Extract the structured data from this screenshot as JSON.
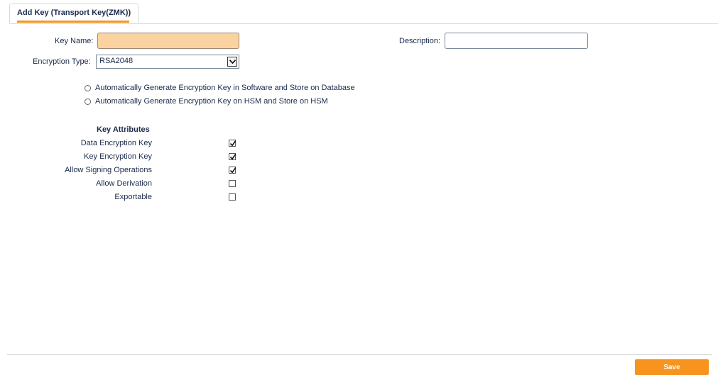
{
  "tab": {
    "label": "Add Key (Transport Key(ZMK))",
    "accent_color": "#f7941d"
  },
  "form": {
    "key_name": {
      "label": "Key Name:",
      "value": "",
      "fill_color": "#fbd3a0"
    },
    "description": {
      "label": "Description:",
      "value": ""
    },
    "encryption_type": {
      "label": "Encryption Type:",
      "selected": "RSA2048",
      "arrow_icon": "chevron-down-icon"
    },
    "generation_options": [
      {
        "label": "Automatically Generate Encryption Key in Software and Store on Database",
        "selected": false
      },
      {
        "label": "Automatically Generate Encryption Key on HSM and Store on HSM",
        "selected": false
      }
    ]
  },
  "key_attributes": {
    "heading": "Key Attributes",
    "items": [
      {
        "label": "Data Encryption Key",
        "checked": true
      },
      {
        "label": "Key Encryption Key",
        "checked": true
      },
      {
        "label": "Allow Signing Operations",
        "checked": true
      },
      {
        "label": "Allow Derivation",
        "checked": false
      },
      {
        "label": "Exportable",
        "checked": false
      }
    ]
  },
  "footer": {
    "save_label": "Save",
    "button_color": "#f7941d"
  }
}
